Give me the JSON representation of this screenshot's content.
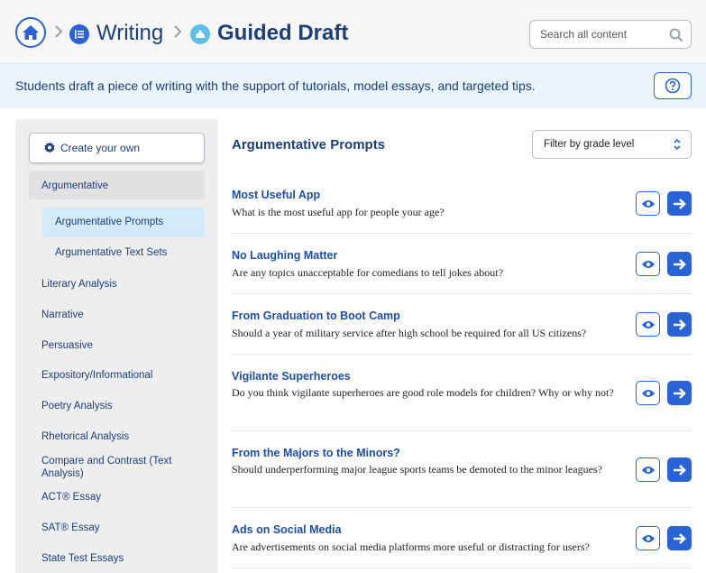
{
  "header": {
    "breadcrumb": [
      {
        "label": "Writing",
        "icon": "writing-list-icon"
      },
      {
        "label": "Guided Draft",
        "icon": "guided-draft-icon"
      }
    ],
    "search_placeholder": "Search all content"
  },
  "banner": {
    "text": "Students draft a piece of writing with the support of tutorials, model essays, and targeted tips.",
    "help_icon": "question-circle-icon"
  },
  "sidebar": {
    "create_label": "Create your own",
    "items": [
      {
        "label": "Argumentative",
        "state": "expanded"
      },
      {
        "label": "Argumentative Prompts",
        "state": "active",
        "level": 2
      },
      {
        "label": "Argumentative Text Sets",
        "level": 2
      },
      {
        "label": "Literary Analysis"
      },
      {
        "label": "Narrative"
      },
      {
        "label": "Persuasive"
      },
      {
        "label": "Expository/Informational"
      },
      {
        "label": "Poetry Analysis"
      },
      {
        "label": "Rhetorical Analysis"
      },
      {
        "label": "Compare and Contrast (Text Analysis)"
      },
      {
        "label": "ACT® Essay"
      },
      {
        "label": "SAT® Essay"
      },
      {
        "label": "State Test Essays"
      }
    ]
  },
  "main": {
    "title": "Argumentative Prompts",
    "filter_label": "Filter by grade level",
    "prompts": [
      {
        "title": "Most Useful App",
        "description": "What is the most useful app for people your age?"
      },
      {
        "title": "No Laughing Matter",
        "description": "Are any topics unacceptable for comedians to tell jokes about?"
      },
      {
        "title": "From Graduation to Boot Camp",
        "description": "Should a year of military service after high school be required for all US citizens?"
      },
      {
        "title": "Vigilante Superheroes",
        "description": "Do you think vigilante superheroes are good role models for children? Why or why not?"
      },
      {
        "title": "From the Majors to the Minors?",
        "description": "Should underperforming major league sports teams be demoted to the minor leagues?"
      },
      {
        "title": "Ads on Social Media",
        "description": "Are advertisements on social media platforms more useful or distracting for users?"
      }
    ]
  },
  "colors": {
    "accent": "#2a63d6",
    "heading": "#1b3f7a",
    "banner_bg": "#e9f4fb",
    "active_bg": "#d3ebf8"
  }
}
